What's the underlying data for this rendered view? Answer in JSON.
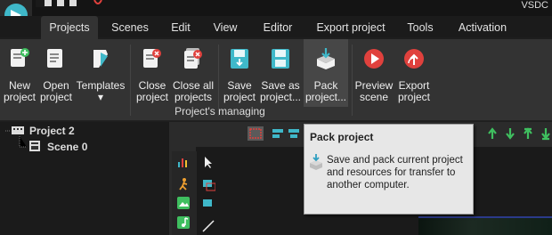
{
  "app": {
    "title": "VSDC"
  },
  "menu": {
    "tabs": [
      {
        "label": "Projects",
        "active": true
      },
      {
        "label": "Scenes"
      },
      {
        "label": "Edit"
      },
      {
        "label": "View"
      },
      {
        "label": "Editor"
      },
      {
        "label": "Export project"
      },
      {
        "label": "Tools"
      },
      {
        "label": "Activation"
      }
    ]
  },
  "ribbon": {
    "buttons": [
      {
        "label": "New\nproject",
        "icon": "new-project-icon"
      },
      {
        "label": "Open\nproject",
        "icon": "open-project-icon"
      },
      {
        "label": "Templates\n▾",
        "icon": "templates-icon"
      },
      {
        "label": "Close\nproject",
        "icon": "close-project-icon"
      },
      {
        "label": "Close all\nprojects",
        "icon": "close-all-projects-icon"
      },
      {
        "label": "Save\nproject",
        "icon": "save-project-icon"
      },
      {
        "label": "Save as\nproject...",
        "icon": "save-as-project-icon"
      },
      {
        "label": "Pack\nproject...",
        "icon": "pack-project-icon"
      },
      {
        "label": "Preview\nscene",
        "icon": "preview-scene-icon"
      },
      {
        "label": "Export\nproject",
        "icon": "export-project-icon"
      }
    ],
    "group_label": "Project's managing"
  },
  "tree": {
    "project": "Project 2",
    "scene": "Scene 0"
  },
  "tooltip": {
    "title": "Pack project",
    "text": "Save and pack current project and resources for transfer to another computer."
  },
  "colors": {
    "accent_teal": "#3fb8c9",
    "green_arrows": "#3fbf5f",
    "red_icons": "#e0413d",
    "ribbon_bg": "#333333"
  }
}
